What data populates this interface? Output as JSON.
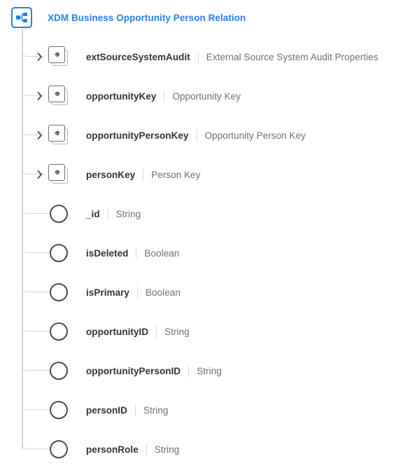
{
  "root": {
    "icon": "schema-hierarchy-icon",
    "title": "XDM Business Opportunity Person Relation",
    "title_color": "#2680EB",
    "border_color": "#2680EB"
  },
  "colors": {
    "accent_blue": "#2680EB",
    "field_name": "#323232",
    "field_type": "#6e6e6e",
    "connector_line": "#d4d4d4",
    "separator": "#d9d9d9",
    "icon_stroke": "#4b4b4b",
    "background": "#ffffff"
  },
  "tree": {
    "rows": [
      {
        "name": "extSourceSystemAudit",
        "type": "External Source System Audit Properties",
        "kind": "object",
        "icon": "linked-object-icon",
        "expandable": true,
        "expanded": false,
        "chevron": "chevron-right-icon"
      },
      {
        "name": "opportunityKey",
        "type": "Opportunity Key",
        "kind": "object",
        "icon": "linked-object-icon",
        "expandable": true,
        "expanded": false,
        "chevron": "chevron-right-icon"
      },
      {
        "name": "opportunityPersonKey",
        "type": "Opportunity Person Key",
        "kind": "object",
        "icon": "linked-object-icon",
        "expandable": true,
        "expanded": false,
        "chevron": "chevron-right-icon"
      },
      {
        "name": "personKey",
        "type": "Person Key",
        "kind": "object",
        "icon": "linked-object-icon",
        "expandable": true,
        "expanded": false,
        "chevron": "chevron-right-icon"
      },
      {
        "name": "_id",
        "type": "String",
        "kind": "field",
        "icon": "circle-field-icon",
        "expandable": false
      },
      {
        "name": "isDeleted",
        "type": "Boolean",
        "kind": "field",
        "icon": "circle-field-icon",
        "expandable": false
      },
      {
        "name": "isPrimary",
        "type": "Boolean",
        "kind": "field",
        "icon": "circle-field-icon",
        "expandable": false
      },
      {
        "name": "opportunityID",
        "type": "String",
        "kind": "field",
        "icon": "circle-field-icon",
        "expandable": false
      },
      {
        "name": "opportunityPersonID",
        "type": "String",
        "kind": "field",
        "icon": "circle-field-icon",
        "expandable": false
      },
      {
        "name": "personID",
        "type": "String",
        "kind": "field",
        "icon": "circle-field-icon",
        "expandable": false
      },
      {
        "name": "personRole",
        "type": "String",
        "kind": "field",
        "icon": "circle-field-icon",
        "expandable": false
      }
    ]
  }
}
